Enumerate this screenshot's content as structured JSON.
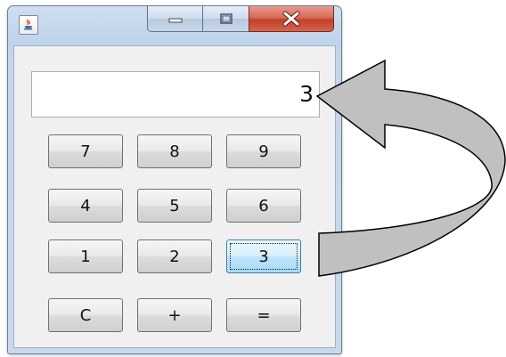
{
  "window": {
    "app_icon": "java-cup-icon",
    "caption_buttons": {
      "minimize": "minimize-icon",
      "maximize": "maximize-icon",
      "close": "close-icon"
    }
  },
  "calculator": {
    "display_value": "3",
    "keys": {
      "row1": [
        "7",
        "8",
        "9"
      ],
      "row2": [
        "4",
        "5",
        "6"
      ],
      "row3": [
        "1",
        "2",
        "3"
      ],
      "row4": [
        "C",
        "+",
        "="
      ]
    },
    "focused_key": "3"
  },
  "annotation": {
    "arrow_fill": "#c0c0c0",
    "arrow_stroke": "#000000",
    "meaning": "curved-arrow-from-key-3-to-display"
  },
  "colors": {
    "pressed_key": "#bee6fd",
    "close_button": "#c24028",
    "frame": "#c4d6ea"
  }
}
